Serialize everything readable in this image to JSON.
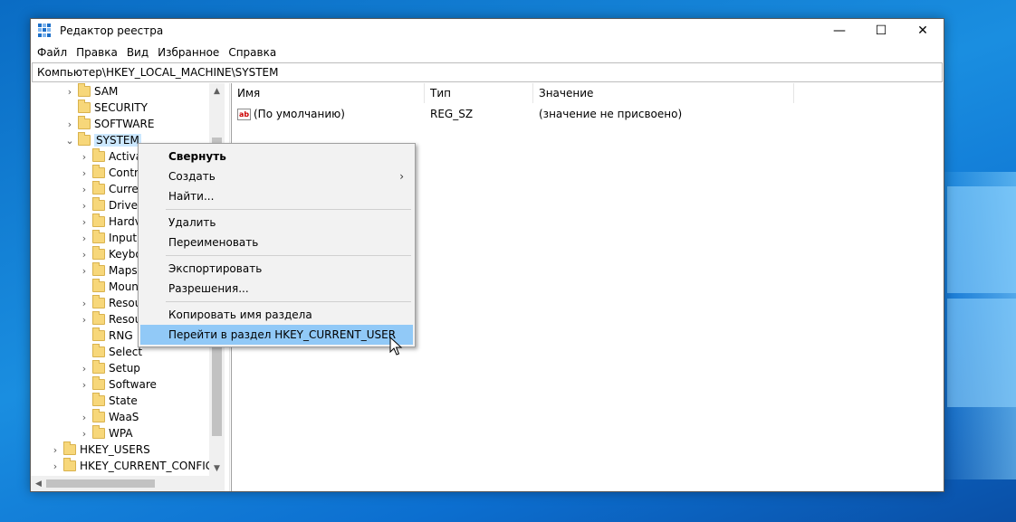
{
  "window": {
    "title": "Редактор реестра",
    "controls": {
      "minimize": "—",
      "maximize": "☐",
      "close": "✕"
    }
  },
  "menubar": [
    "Файл",
    "Правка",
    "Вид",
    "Избранное",
    "Справка"
  ],
  "address": "Компьютер\\HKEY_LOCAL_MACHINE\\SYSTEM",
  "tree": [
    {
      "label": "SAM",
      "chev": "›"
    },
    {
      "label": "SECURITY",
      "chev": ""
    },
    {
      "label": "SOFTWARE",
      "chev": "›"
    },
    {
      "label": "SYSTEM",
      "chev": "⌄"
    },
    {
      "label": "Activa",
      "chev": "›"
    },
    {
      "label": "Contr",
      "chev": "›"
    },
    {
      "label": "Curre",
      "chev": "›"
    },
    {
      "label": "Driver",
      "chev": "›"
    },
    {
      "label": "Hardv",
      "chev": "›"
    },
    {
      "label": "Input",
      "chev": "›"
    },
    {
      "label": "Keybo",
      "chev": "›"
    },
    {
      "label": "Maps",
      "chev": "›"
    },
    {
      "label": "Moun",
      "chev": ""
    },
    {
      "label": "Resou",
      "chev": "›"
    },
    {
      "label": "Resou",
      "chev": "›"
    },
    {
      "label": "RNG",
      "chev": ""
    },
    {
      "label": "Select",
      "chev": ""
    },
    {
      "label": "Setup",
      "chev": "›"
    },
    {
      "label": "Software",
      "chev": "›"
    },
    {
      "label": "State",
      "chev": ""
    },
    {
      "label": "WaaS",
      "chev": "›"
    },
    {
      "label": "WPA",
      "chev": "›"
    },
    {
      "label": "HKEY_USERS",
      "chev": "›"
    },
    {
      "label": "HKEY_CURRENT_CONFIG",
      "chev": "›"
    }
  ],
  "list": {
    "columns": [
      "Имя",
      "Тип",
      "Значение"
    ],
    "rows": [
      {
        "name": "(По умолчанию)",
        "type": "REG_SZ",
        "value": "(значение не присвоено)",
        "icon": "ab"
      }
    ]
  },
  "context_menu": [
    {
      "label": "Свернуть",
      "bold": true
    },
    {
      "label": "Создать",
      "submenu": "›"
    },
    {
      "label": "Найти..."
    },
    {
      "label": "Удалить"
    },
    {
      "label": "Переименовать"
    },
    {
      "label": "Экспортировать"
    },
    {
      "label": "Разрешения..."
    },
    {
      "label": "Копировать имя раздела"
    },
    {
      "label": "Перейти в раздел HKEY_CURRENT_USER",
      "hover": true
    }
  ],
  "scroll_arrows": {
    "up": "▲",
    "down": "▼",
    "left": "◀",
    "right": "▶"
  },
  "colors": {
    "selection": "#cce8ff",
    "menu_hover": "#91c9f7",
    "folder": "#f7d77a"
  }
}
